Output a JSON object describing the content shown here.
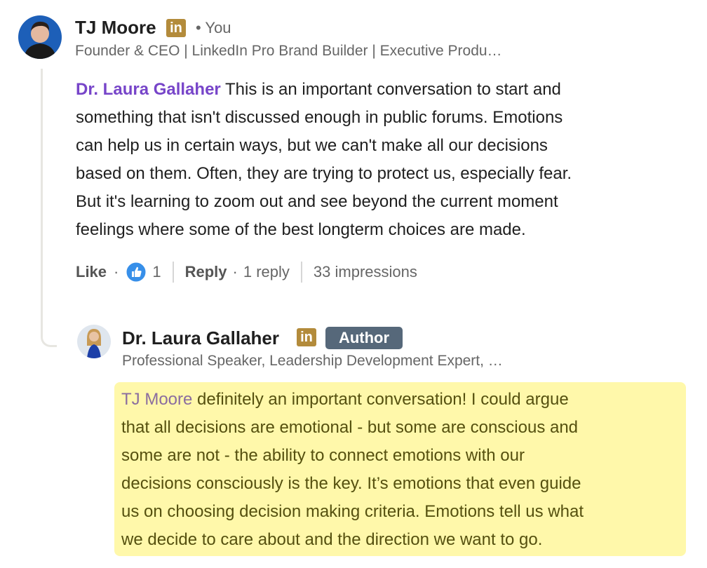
{
  "comment": {
    "author": "TJ Moore",
    "badge_text": "in",
    "relation": "• You",
    "headline": "Founder & CEO | LinkedIn Pro Brand Builder | Executive Produ…",
    "mention": "Dr. Laura Gallaher",
    "lines": [
      "This is an important conversation to start and",
      "something that isn't discussed enough in public forums. Emotions",
      "can help us in certain ways, but we can't make all our decisions",
      "based on them. Often, they are trying to protect us, especially fear.",
      "But it's learning to zoom out and see beyond the current moment",
      "feelings where some of the best longterm choices are made."
    ],
    "actions": {
      "like_label": "Like",
      "dot1": "·",
      "like_count": "1",
      "reply_label": "Reply",
      "dot2": "·",
      "reply_count": "1 reply",
      "impressions": "33 impressions"
    }
  },
  "reply": {
    "author": "Dr. Laura Gallaher",
    "badge_text": "in",
    "author_badge": "Author",
    "headline": "Professional Speaker, Leadership Development Expert, …",
    "mention": "TJ Moore",
    "lines": [
      "definitely an important conversation! I could argue",
      "that all decisions are emotional - but some are conscious and",
      "some are not - the ability to connect emotions with our",
      "decisions consciously is the key. It’s emotions that even guide",
      "us on choosing decision making criteria. Emotions tell us what",
      "we decide to care about and the direction we want to go."
    ]
  },
  "colors": {
    "linkedin_badge": "#b38b3b",
    "mention_purple": "#7745c9",
    "author_badge_bg": "#56687a",
    "highlight": "#fff8aa",
    "like_icon": "#378fe9"
  },
  "icons": {
    "like": "thumbs-up-icon",
    "linkedin": "linkedin-icon"
  }
}
